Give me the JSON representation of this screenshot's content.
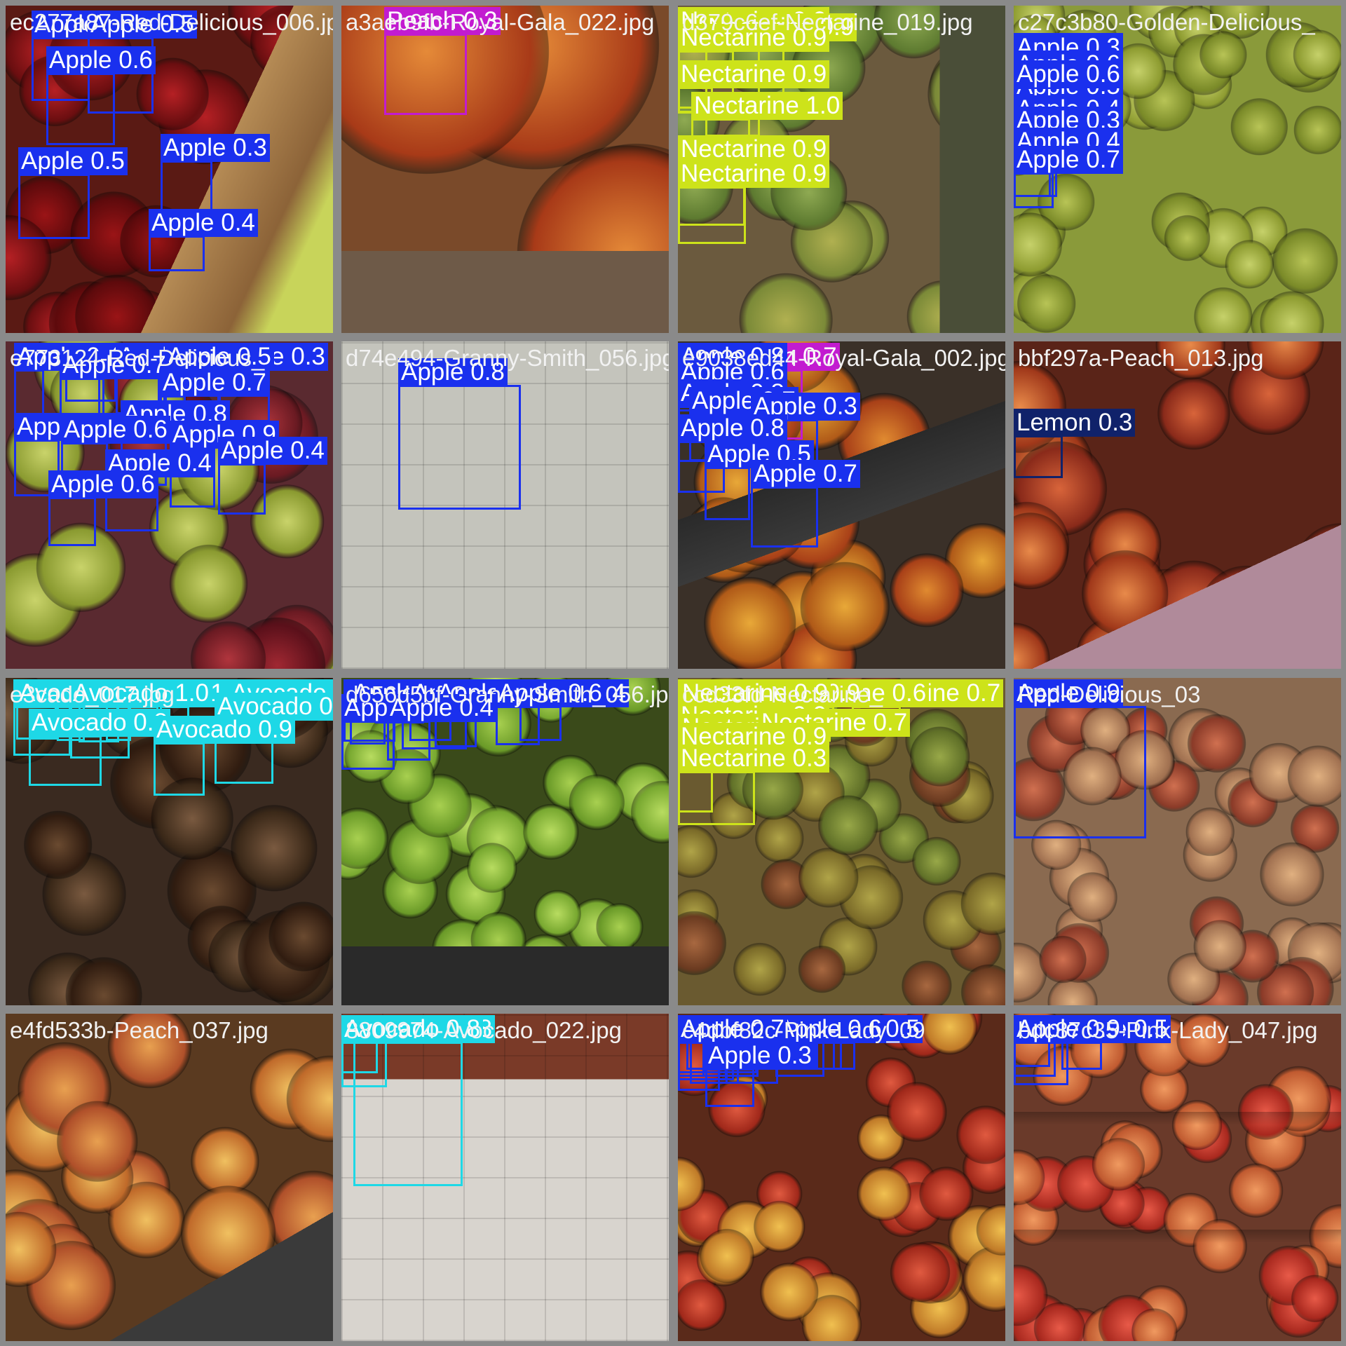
{
  "colors": {
    "apple": "#1a30ee",
    "nectarine": "#cde31a",
    "peach": "#c21bd0",
    "avocado": "#1ed8e6",
    "lemon": "#10226a",
    "tile_gap": "#8a8a8a"
  },
  "tiles": [
    {
      "filename": "ec277a87-Red-Delicious_006.jpg",
      "scene": "red-apples",
      "detections": [
        {
          "label": "Apple 0.5",
          "cls": "apple"
        },
        {
          "label": "Apple 0.5",
          "cls": "apple"
        },
        {
          "label": "Apple 0.6",
          "cls": "apple"
        },
        {
          "label": "Apple 0.3",
          "cls": "apple"
        },
        {
          "label": "Apple 0.5",
          "cls": "apple"
        },
        {
          "label": "Apple 0.4",
          "cls": "apple"
        }
      ]
    },
    {
      "filename": "a3aeb9fb-Royal-Gala_022.jpg",
      "scene": "gala-closeup",
      "detections": [
        {
          "label": "Peach 0.3",
          "cls": "peach"
        }
      ]
    },
    {
      "filename": "d379c6ef-Nectarine_019.jpg",
      "scene": "nectarines",
      "detections": [
        {
          "label": "Nectarine 0.9",
          "cls": "nectarine"
        },
        {
          "label": "Nectarine 0.9",
          "cls": "nectarine"
        },
        {
          "label": "Nectarine 0.9",
          "cls": "nectarine"
        },
        {
          "label": "Nectarine 0.9",
          "cls": "nectarine"
        },
        {
          "label": "Nectarine 1.0",
          "cls": "nectarine"
        },
        {
          "label": "Nectarine 0.9",
          "cls": "nectarine"
        },
        {
          "label": "Nectarine 0.9",
          "cls": "nectarine"
        }
      ]
    },
    {
      "filename": "c27c3b80-Golden-Delicious_",
      "scene": "golden-apples",
      "detections": [
        {
          "label": "Apple 0.3",
          "cls": "apple"
        },
        {
          "label": "Apple 0.3",
          "cls": "apple"
        },
        {
          "label": "Apple 0.6",
          "cls": "apple"
        },
        {
          "label": "Apple 0.5",
          "cls": "apple"
        },
        {
          "label": "Apple 0.6",
          "cls": "apple"
        },
        {
          "label": "Apple 0.4",
          "cls": "apple"
        },
        {
          "label": "Apple 0.3",
          "cls": "apple"
        },
        {
          "label": "Apple 0.4",
          "cls": "apple"
        },
        {
          "label": "Apple 0.4",
          "cls": "apple"
        },
        {
          "label": "Apple 0.7",
          "cls": "apple"
        }
      ]
    },
    {
      "filename": "e773124-Red-Delicious_",
      "scene": "mixed-apples",
      "detections": [
        {
          "label": "Apple 0.5",
          "cls": "apple"
        },
        {
          "label": "Apple 0.3",
          "cls": "apple"
        },
        {
          "label": "Apple 0.3",
          "cls": "apple"
        },
        {
          "label": "Apple 0.4",
          "cls": "apple"
        },
        {
          "label": "Apple 0.4",
          "cls": "apple"
        },
        {
          "label": "Apple 0.5",
          "cls": "apple"
        },
        {
          "label": "Apple 0.7",
          "cls": "apple"
        },
        {
          "label": "Apple 0.7",
          "cls": "apple"
        },
        {
          "label": "Apple 0.8",
          "cls": "apple"
        },
        {
          "label": "Apple 0.5",
          "cls": "apple"
        },
        {
          "label": "Apple 0.6",
          "cls": "apple"
        },
        {
          "label": "Apple 0.9",
          "cls": "apple"
        },
        {
          "label": "Apple 0.4",
          "cls": "apple"
        },
        {
          "label": "Apple 0.4",
          "cls": "apple"
        },
        {
          "label": "Apple 0.6",
          "cls": "apple"
        }
      ]
    },
    {
      "filename": "d74e494-Granny-Smith_056.jpg",
      "scene": "green-hand",
      "detections": [
        {
          "label": "Apple 0.8",
          "cls": "apple"
        }
      ]
    },
    {
      "filename": "e9038ed44-Royal-Gala_002.jpg",
      "scene": "gala-crate",
      "detections": [
        {
          "label": "Peach 0.7",
          "cls": "peach"
        },
        {
          "label": "Apple 0.8",
          "cls": "apple"
        },
        {
          "label": "Apple 0.6",
          "cls": "apple"
        },
        {
          "label": "Apple 0.8",
          "cls": "apple"
        },
        {
          "label": "Apple 0.7",
          "cls": "apple"
        },
        {
          "label": "Apple 0.3",
          "cls": "apple"
        },
        {
          "label": "Apple 0.8",
          "cls": "apple"
        },
        {
          "label": "Apple 0.5",
          "cls": "apple"
        },
        {
          "label": "Apple 0.7",
          "cls": "apple"
        }
      ]
    },
    {
      "filename": "bbf297a-Peach_013.jpg",
      "scene": "peach-crate",
      "detections": [
        {
          "label": "Lemon 0.3",
          "cls": "lemon"
        }
      ]
    },
    {
      "filename": "e3cado_017.jpg",
      "scene": "avocados",
      "detections": [
        {
          "label": "Avocado 0.9",
          "cls": "avocado"
        },
        {
          "label": "Avocado 0.4",
          "cls": "avocado"
        },
        {
          "label": "Avocado 0.9",
          "cls": "avocado"
        },
        {
          "label": "Avocado 0.7",
          "cls": "avocado"
        },
        {
          "label": "Avocado 0.9",
          "cls": "avocado"
        },
        {
          "label": "Avocado 0.9",
          "cls": "avocado"
        },
        {
          "label": "Avocado 1.0",
          "cls": "avocado"
        },
        {
          "label": "Avocado 1.0",
          "cls": "avocado"
        },
        {
          "label": "Avocado 0.9",
          "cls": "avocado"
        },
        {
          "label": "Avocado 0.3",
          "cls": "avocado"
        },
        {
          "label": "Avocado 1.0",
          "cls": "avocado"
        },
        {
          "label": "Avocado 0.8",
          "cls": "avocado"
        },
        {
          "label": "Avocado 0.8",
          "cls": "avocado"
        },
        {
          "label": "Avocado 0.9",
          "cls": "avocado"
        }
      ]
    },
    {
      "filename": "d656d5bf-Granny-Smith_056.jpg",
      "scene": "green-apples",
      "detections": [
        {
          "label": "Apple 0.3",
          "cls": "apple"
        },
        {
          "label": "Apple 0.3",
          "cls": "apple"
        },
        {
          "label": "Apple 0.6",
          "cls": "apple"
        },
        {
          "label": "Apple 0.5",
          "cls": "apple"
        },
        {
          "label": "Apple 0.6",
          "cls": "apple"
        },
        {
          "label": "Apple 0.4",
          "cls": "apple"
        },
        {
          "label": "Apple 0.3",
          "cls": "apple"
        },
        {
          "label": "Apple 0.6",
          "cls": "apple"
        },
        {
          "label": "Apple 0.4",
          "cls": "apple"
        },
        {
          "label": "Apple 0.4",
          "cls": "apple"
        }
      ]
    },
    {
      "filename": "ccd33fd-Nectarine_",
      "scene": "nectarines-dense",
      "detections": [
        {
          "label": "Nectarine 0.4",
          "cls": "nectarine"
        },
        {
          "label": "Nectarine 0.3",
          "cls": "nectarine"
        },
        {
          "label": "Nectarine 0.5",
          "cls": "nectarine"
        },
        {
          "label": "Nectarine 0.7",
          "cls": "nectarine"
        },
        {
          "label": "Nectarine 0.5",
          "cls": "nectarine"
        },
        {
          "label": "Nectarine 0.9",
          "cls": "nectarine"
        },
        {
          "label": "Nectarine 0.4",
          "cls": "nectarine"
        },
        {
          "label": "Nectarine 0.6",
          "cls": "nectarine"
        },
        {
          "label": "Nectarine 0.3",
          "cls": "nectarine"
        },
        {
          "label": "Nectarine 0.9",
          "cls": "nectarine"
        },
        {
          "label": "Nectarine 0.9",
          "cls": "nectarine"
        },
        {
          "label": "Nectarine 0.8",
          "cls": "nectarine"
        },
        {
          "label": "Nectarine 0.9",
          "cls": "nectarine"
        },
        {
          "label": "Nectarine 0.9",
          "cls": "nectarine"
        },
        {
          "label": "Nectarine 0.9",
          "cls": "nectarine"
        },
        {
          "label": "Nectarine 0.7",
          "cls": "nectarine"
        },
        {
          "label": "Nectarine 0.9",
          "cls": "nectarine"
        },
        {
          "label": "Nectarine 0.3",
          "cls": "nectarine"
        }
      ]
    },
    {
      "filename": "Red-Delicious_03",
      "scene": "red-hand",
      "detections": [
        {
          "label": "Apple 0.9",
          "cls": "apple"
        }
      ]
    },
    {
      "filename": "e4fd533b-Peach_037.jpg",
      "scene": "peaches",
      "detections": []
    },
    {
      "filename": "8809974-Avocado_022.jpg",
      "scene": "avocado-hand",
      "detections": [
        {
          "label": "Avocado 0.8",
          "cls": "avocado"
        },
        {
          "label": "Avocado 0.8",
          "cls": "avocado"
        },
        {
          "label": "Avocado 0.8",
          "cls": "avocado"
        }
      ]
    },
    {
      "filename": "c4dbf82c-Pink-Lady_09",
      "scene": "pink-apples",
      "detections": [
        {
          "label": "Apple 0.6",
          "cls": "apple"
        },
        {
          "label": "Apple 0.7",
          "cls": "apple"
        },
        {
          "label": "Apple 0.8",
          "cls": "apple"
        },
        {
          "label": "Apple 0.7",
          "cls": "apple"
        },
        {
          "label": "Apple 0.4",
          "cls": "apple"
        },
        {
          "label": "Apple 0.3",
          "cls": "apple"
        },
        {
          "label": "Apple 0.3",
          "cls": "apple"
        },
        {
          "label": "Apple 0.3",
          "cls": "apple"
        },
        {
          "label": "Apple 0.4",
          "cls": "apple"
        },
        {
          "label": "Apple 0.4",
          "cls": "apple"
        },
        {
          "label": "Apple 0.5",
          "cls": "apple"
        },
        {
          "label": "Apple 0.4",
          "cls": "apple"
        },
        {
          "label": "Apple 0.4",
          "cls": "apple"
        },
        {
          "label": "Apple 0.5",
          "cls": "apple"
        },
        {
          "label": "Apple 0.3",
          "cls": "apple"
        },
        {
          "label": "Apple 0.6",
          "cls": "apple"
        },
        {
          "label": "Apple 0.6",
          "cls": "apple"
        },
        {
          "label": "Apple 0.7",
          "cls": "apple"
        },
        {
          "label": "Apple 0.3",
          "cls": "apple"
        }
      ]
    },
    {
      "filename": "bdc87c35-Pink-Lady_047.jpg",
      "scene": "pink-crate",
      "detections": [
        {
          "label": "Apple 0.4",
          "cls": "apple"
        },
        {
          "label": "Apple 0.5",
          "cls": "apple"
        },
        {
          "label": "Apple 0.3",
          "cls": "apple"
        },
        {
          "label": "Apple 0.9",
          "cls": "apple"
        }
      ]
    }
  ]
}
